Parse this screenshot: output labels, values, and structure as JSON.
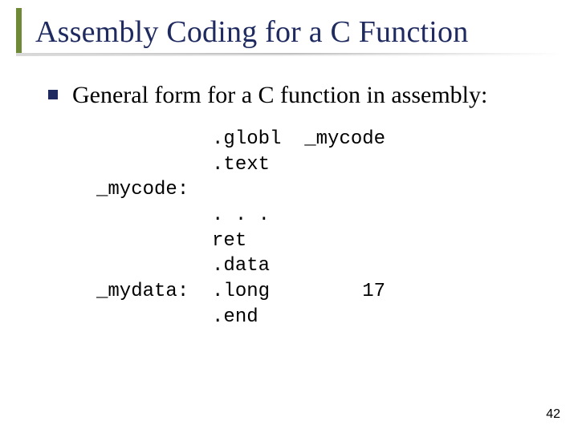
{
  "title": "Assembly Coding for a C Function",
  "bullet": "General form for a C function in assembly:",
  "code": {
    "l1": "          .globl  _mycode",
    "l2": "          .text",
    "l3": "_mycode:",
    "l4": "          . . .",
    "l5": "          ret",
    "l6": "          .data",
    "l7": "_mydata:  .long        17",
    "l8": "          .end"
  },
  "page_number": "42"
}
